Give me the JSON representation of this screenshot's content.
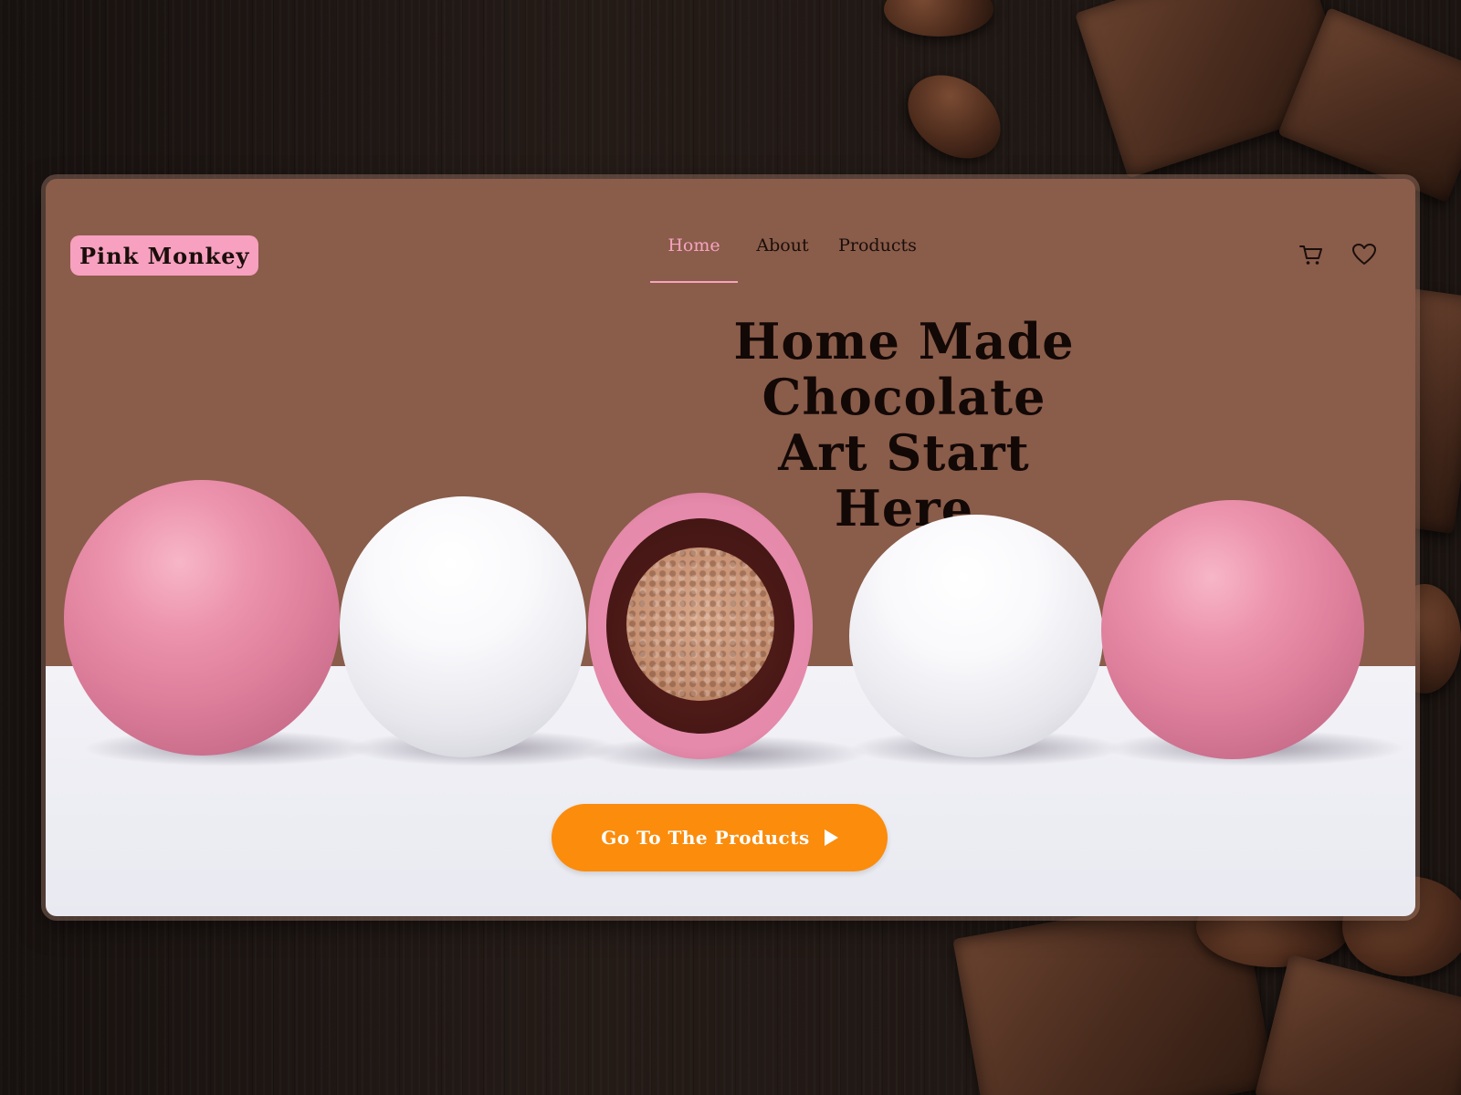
{
  "brand": {
    "name": "Pink Monkey"
  },
  "nav": {
    "items": [
      {
        "label": "Home",
        "active": true
      },
      {
        "label": "About",
        "active": false
      },
      {
        "label": "Products",
        "active": false
      }
    ]
  },
  "header_icons": {
    "cart": "cart-icon",
    "wishlist": "heart-icon"
  },
  "hero": {
    "title_lines": [
      "Home Made",
      "Chocolate",
      "Art Start",
      "Here"
    ],
    "cta_label": "Go To The Products",
    "cta_icon": "play-triangle-icon"
  },
  "colors": {
    "card_background": "#8a5c4a",
    "brand_pink": "#f7a0bf",
    "active_nav": "#f6a3c1",
    "cta": "#fb8c0c",
    "text_dark": "#120806"
  }
}
